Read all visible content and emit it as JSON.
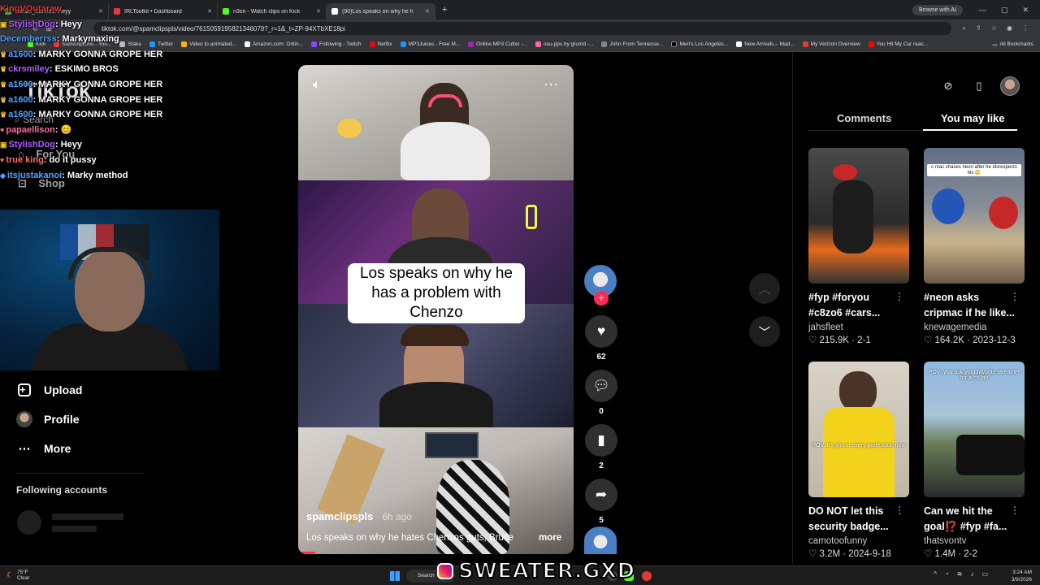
{
  "browser": {
    "tabs": [
      {
        "title": "Denzo_Banned: Heyy",
        "color": "#4caf50"
      },
      {
        "title": "IRLToolkit • Dashboard",
        "color": "#e53935"
      },
      {
        "title": "n3on - Watch clips on Kick",
        "color": "#53fc18"
      },
      {
        "title": "(90)Los speaks on why he h",
        "color": "#ffffff"
      }
    ],
    "browse_ai": "Browse with AI",
    "url": "tiktok.com/@spamclipspls/video/7615059195821346079?_r=1&_t=ZP-94XTbXE18pi",
    "bookmarks": [
      "Kick",
      "Subscriptions - You...",
      "Stake",
      "Twitter",
      "Video to animated...",
      "Amazon.com: Onlin...",
      "Following - Twitch",
      "Netflix",
      "MP3Juices - Free M...",
      "Online MP3 Cutter -...",
      "osu-pps by grumd -...",
      "John From Tennesse...",
      "Men's Los Angeles...",
      "New Arrivals – Mad...",
      "My Verizon Overview",
      "You Hit My Car reac..."
    ],
    "all_bookmarks": "All Bookmarks"
  },
  "chat": [
    {
      "user": "KingVOutaraw",
      "color": "#e53935",
      "msg": ""
    },
    {
      "user": "StylishDog",
      "color": "#b05cff",
      "msg": "Heyy"
    },
    {
      "user": "Decemberrss",
      "color": "#4ea3ff",
      "msg": "Markymaxing"
    },
    {
      "user": "a1600",
      "color": "#4ea3ff",
      "msg": "MARKY GONNA GROPE HER"
    },
    {
      "user": "ckrsmiley",
      "color": "#b05cff",
      "msg": "ESKIMO BROS"
    },
    {
      "user": "a1600",
      "color": "#4ea3ff",
      "msg": "MARKY GONNA GROPE HER"
    },
    {
      "user": "a1600",
      "color": "#4ea3ff",
      "msg": "MARKY GONNA GROPE HER"
    },
    {
      "user": "a1600",
      "color": "#4ea3ff",
      "msg": "MARKY GONNA GROPE HER"
    },
    {
      "user": "papaellison",
      "color": "#ff6b9a",
      "msg": "😊"
    },
    {
      "user": "StylishDog",
      "color": "#b05cff",
      "msg": "Heyy"
    },
    {
      "user": "true king",
      "color": "#ff6b6b",
      "msg": "do it pussy"
    },
    {
      "user": "itsjustakanoi",
      "color": "#4ea3ff",
      "msg": "Marky method"
    }
  ],
  "tiktok": {
    "logo": "TikTok",
    "search": "Search",
    "for_you": "For You",
    "shop": "Shop",
    "nav": {
      "upload": "Upload",
      "profile": "Profile",
      "more": "More"
    },
    "following_accounts": "Following accounts"
  },
  "video": {
    "caption": "Los speaks on why he has a problem with Chenzo",
    "author": "spamclipspls",
    "time": "· 6h ago",
    "description": "Los speaks on why he hates Chenzos guts, Bruce",
    "more": "more",
    "likes": "62",
    "comments": "0",
    "saves": "2",
    "shares": "5",
    "progress": 0.05
  },
  "panel": {
    "tab_comments": "Comments",
    "tab_you_may_like": "You may like",
    "cards": [
      {
        "title": "#fyp #foryou #c8zo6 #cars...",
        "author": "jahsfleet",
        "stats": "♡ 215.9K · 2-1",
        "thumb_text": "",
        "colors": [
          "#3a3a3a",
          "#e86a1c"
        ]
      },
      {
        "title": "#neon asks cripmac if he like...",
        "author": "knewagemedia",
        "stats": "♡ 164.2K · 2023-12-3",
        "thumb_text": "c mac chases neon after he disrespects his 😳",
        "colors": [
          "#5f6e85",
          "#c9b48a"
        ]
      },
      {
        "title": "DO NOT let this security badge...",
        "author": "camotoofunny",
        "stats": "♡ 3.2M · 2024-9-18",
        "thumb_text": "POV: it's yns in every profession now",
        "colors": [
          "#cfc6b5",
          "#f2d21b"
        ]
      },
      {
        "title": "Can we hit the goal⁉️ #fyp #fa...",
        "author": "thatsvontv",
        "stats": "♡ 1.4M · 2-2",
        "thumb_text": "POV: you ask your favorite streamer for a collab",
        "colors": [
          "#8fb8e0",
          "#2a2a2a"
        ]
      }
    ]
  },
  "taskbar": {
    "temp": "75°F",
    "weather": "Clear",
    "search": "Search",
    "time": "3:24 AM",
    "date": "3/9/2026"
  },
  "watermark": "SWEATER.GXD"
}
